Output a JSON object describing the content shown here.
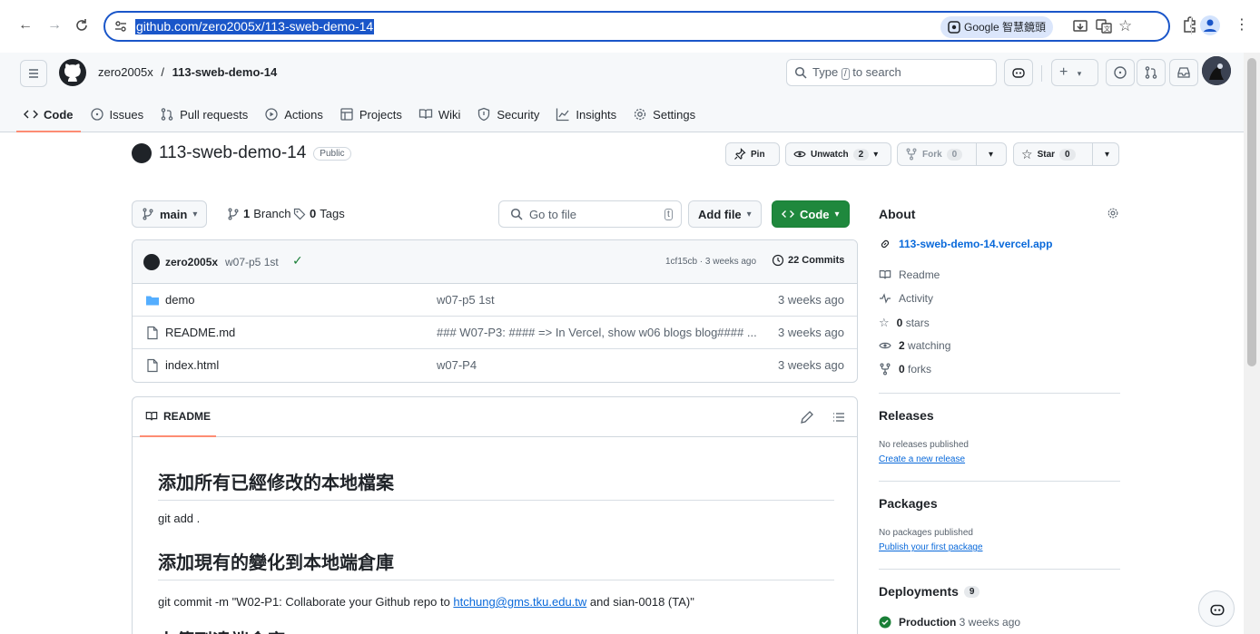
{
  "browser": {
    "url": "github.com/zero2005x/113-sweb-demo-14",
    "lens_chip": "Google 智慧鏡頭",
    "nav_icons": [
      "back-icon",
      "forward-icon",
      "reload-icon",
      "site-info-icon"
    ]
  },
  "header": {
    "owner": "zero2005x",
    "separator": "/",
    "repo": "113-sweb-demo-14",
    "search_prefix": "Type",
    "search_key": "/",
    "search_suffix": "to search"
  },
  "tabs": [
    {
      "label": "Code",
      "icon": "code-icon",
      "active": true
    },
    {
      "label": "Issues",
      "icon": "issue-icon"
    },
    {
      "label": "Pull requests",
      "icon": "pull-request-icon"
    },
    {
      "label": "Actions",
      "icon": "play-icon"
    },
    {
      "label": "Projects",
      "icon": "table-icon"
    },
    {
      "label": "Wiki",
      "icon": "book-icon"
    },
    {
      "label": "Security",
      "icon": "shield-icon"
    },
    {
      "label": "Insights",
      "icon": "graph-icon"
    },
    {
      "label": "Settings",
      "icon": "gear-icon"
    }
  ],
  "repo": {
    "name": "113-sweb-demo-14",
    "visibility": "Public",
    "pin": "Pin",
    "unwatch": "Unwatch",
    "watch_count": "2",
    "fork": "Fork",
    "fork_count": "0",
    "star": "Star",
    "star_count": "0"
  },
  "branch": {
    "name": "main",
    "branches_count": "1",
    "branches_label": "Branch",
    "tags_count": "0",
    "tags_label": "Tags",
    "goto_placeholder": "Go to file",
    "goto_key": "t",
    "add_file": "Add file",
    "code": "Code"
  },
  "commit": {
    "author": "zero2005x",
    "message": "w07-p5 1st",
    "hash_time": "1cf15cb · 3 weeks ago",
    "commits": "22 Commits"
  },
  "files": [
    {
      "name": "demo",
      "type": "folder",
      "message": "w07-p5 1st",
      "time": "3 weeks ago"
    },
    {
      "name": "README.md",
      "type": "file",
      "message": "### W07-P3: #### => In Vercel, show w06 blogs blog#### ...",
      "time": "3 weeks ago"
    },
    {
      "name": "index.html",
      "type": "file",
      "message": "w07-P4",
      "time": "3 weeks ago"
    }
  ],
  "readme": {
    "tab": "README",
    "h1": "添加所有已經修改的本地檔案",
    "p1": "git add .",
    "h2": "添加現有的變化到本地端倉庫",
    "p2_prefix": "git commit -m \"W02-P1: Collaborate your Github repo to ",
    "p2_link": "htchung@gms.tku.edu.tw",
    "p2_suffix": " and sian-0018 (TA)\"",
    "h3": "上傳到遠端倉庫"
  },
  "about": {
    "title": "About",
    "link": "113-sweb-demo-14.vercel.app",
    "readme": "Readme",
    "activity": "Activity",
    "stars_count": "0",
    "stars_label": "stars",
    "watching_count": "2",
    "watching_label": "watching",
    "forks_count": "0",
    "forks_label": "forks"
  },
  "releases": {
    "title": "Releases",
    "empty": "No releases published",
    "link": "Create a new release"
  },
  "packages": {
    "title": "Packages",
    "empty": "No packages published",
    "link": "Publish your first package"
  },
  "deployments": {
    "title": "Deployments",
    "count": "9",
    "env": "Production",
    "time": "3 weeks ago"
  },
  "colors": {
    "accent": "#1a56c9",
    "tab_underline": "#fd8c73",
    "code_button": "#1f883d",
    "link": "#0969da"
  }
}
